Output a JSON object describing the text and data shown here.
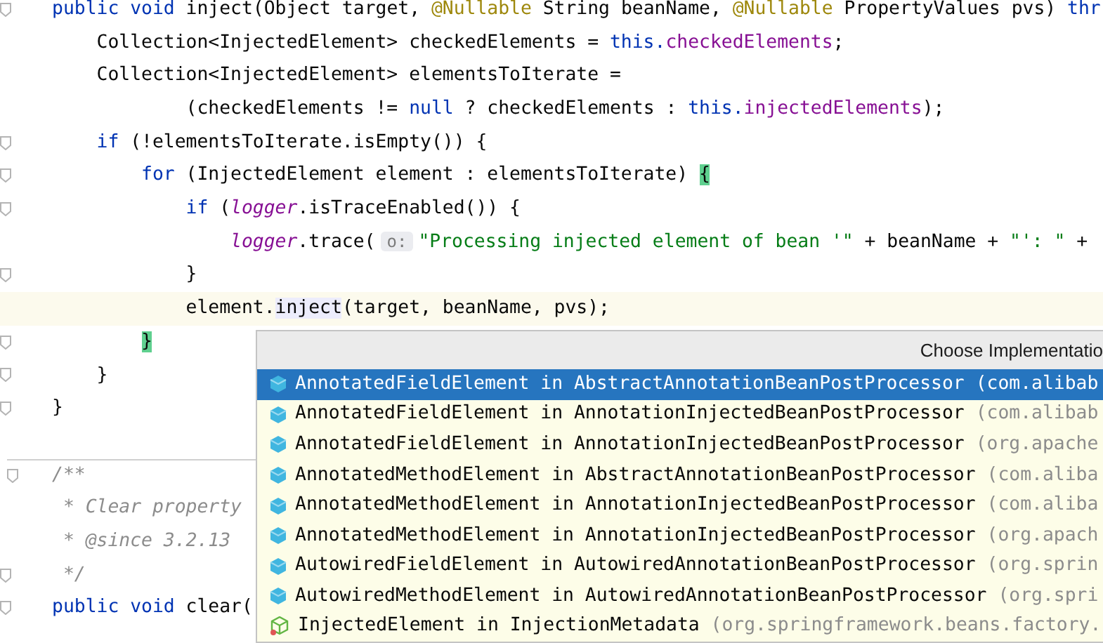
{
  "editor": {
    "lines": [
      {
        "fold": true,
        "tokens": [
          {
            "kind": "kw",
            "text": "public void "
          },
          {
            "kind": "plain",
            "text": "inject(Object target, "
          },
          {
            "kind": "ann",
            "text": "@Nullable"
          },
          {
            "kind": "plain",
            "text": " String beanName, "
          },
          {
            "kind": "ann",
            "text": "@Nullable"
          },
          {
            "kind": "plain",
            "text": " PropertyValues pvs) "
          },
          {
            "kind": "kw",
            "text": "thr"
          }
        ]
      },
      {
        "tokens": [
          {
            "kind": "plain",
            "text": "    Collection<InjectedElement> checkedElements = "
          },
          {
            "kind": "kw",
            "text": "this."
          },
          {
            "kind": "field",
            "text": "checkedElements"
          },
          {
            "kind": "plain",
            "text": ";"
          }
        ]
      },
      {
        "tokens": [
          {
            "kind": "plain",
            "text": "    Collection<InjectedElement> elementsToIterate ="
          }
        ]
      },
      {
        "tokens": [
          {
            "kind": "plain",
            "text": "            (checkedElements != "
          },
          {
            "kind": "kw",
            "text": "null"
          },
          {
            "kind": "plain",
            "text": " ? checkedElements : "
          },
          {
            "kind": "kw",
            "text": "this."
          },
          {
            "kind": "field",
            "text": "injectedElements"
          },
          {
            "kind": "plain",
            "text": ");"
          }
        ]
      },
      {
        "fold": true,
        "tokens": [
          {
            "kind": "kw",
            "text": "    if"
          },
          {
            "kind": "plain",
            "text": " (!elementsToIterate.isEmpty()) {"
          }
        ]
      },
      {
        "fold": true,
        "tokens": [
          {
            "kind": "kw",
            "text": "        for"
          },
          {
            "kind": "plain",
            "text": " (InjectedElement element : elementsToIterate) "
          },
          {
            "kind": "match",
            "text": "{"
          }
        ]
      },
      {
        "fold": true,
        "tokens": [
          {
            "kind": "kw",
            "text": "            if"
          },
          {
            "kind": "plain",
            "text": " ("
          },
          {
            "kind": "static",
            "text": "logger"
          },
          {
            "kind": "plain",
            "text": ".isTraceEnabled()) {"
          }
        ]
      },
      {
        "tokens": [
          {
            "kind": "static",
            "text": "                logger"
          },
          {
            "kind": "plain",
            "text": ".trace("
          },
          {
            "kind": "hint",
            "text": "o:"
          },
          {
            "kind": "str",
            "text": "\"Processing injected element of bean '\""
          },
          {
            "kind": "plain",
            "text": " + beanName + "
          },
          {
            "kind": "str",
            "text": "\"': \""
          },
          {
            "kind": "plain",
            "text": " +"
          }
        ]
      },
      {
        "fold": true,
        "tokens": [
          {
            "kind": "plain",
            "text": "            }"
          }
        ]
      },
      {
        "caret": true,
        "tokens": [
          {
            "kind": "plain",
            "text": "            element."
          },
          {
            "kind": "usage",
            "text": "inject"
          },
          {
            "kind": "plain",
            "text": "(target, beanName, pvs);"
          }
        ]
      },
      {
        "fold": true,
        "tokens": [
          {
            "kind": "match",
            "text": "        }"
          }
        ]
      },
      {
        "fold": true,
        "tokens": [
          {
            "kind": "plain",
            "text": "    }"
          }
        ]
      },
      {
        "fold": true,
        "tokens": [
          {
            "kind": "plain",
            "text": "}"
          }
        ]
      },
      {
        "fold": true,
        "separator": true,
        "tokens": [
          {
            "kind": "comment",
            "text": "/**"
          }
        ]
      },
      {
        "tokens": [
          {
            "kind": "comment",
            "text": " * Clear property"
          }
        ]
      },
      {
        "tokens": [
          {
            "kind": "comment",
            "text": " * @since 3.2.13"
          }
        ]
      },
      {
        "fold": true,
        "tokens": [
          {
            "kind": "comment",
            "text": " */"
          }
        ]
      },
      {
        "fold": true,
        "tokens": [
          {
            "kind": "kw",
            "text": "public void "
          },
          {
            "kind": "plain",
            "text": "clear("
          }
        ]
      }
    ]
  },
  "popup": {
    "title": "Choose Implementatio",
    "items": [
      {
        "kind": "class",
        "selected": true,
        "label": "AnnotatedFieldElement in AbstractAnnotationBeanPostProcessor",
        "package": "(com.alibab"
      },
      {
        "kind": "class",
        "selected": false,
        "label": "AnnotatedFieldElement in AnnotationInjectedBeanPostProcessor",
        "package": "(com.alibab"
      },
      {
        "kind": "class",
        "selected": false,
        "label": "AnnotatedFieldElement in AnnotationInjectedBeanPostProcessor",
        "package": "(org.apache"
      },
      {
        "kind": "class",
        "selected": false,
        "label": "AnnotatedMethodElement in AbstractAnnotationBeanPostProcessor",
        "package": "(com.aliba"
      },
      {
        "kind": "class",
        "selected": false,
        "label": "AnnotatedMethodElement in AnnotationInjectedBeanPostProcessor",
        "package": "(com.aliba"
      },
      {
        "kind": "class",
        "selected": false,
        "label": "AnnotatedMethodElement in AnnotationInjectedBeanPostProcessor",
        "package": "(org.apach"
      },
      {
        "kind": "class",
        "selected": false,
        "label": "AutowiredFieldElement in AutowiredAnnotationBeanPostProcessor",
        "package": "(org.sprin"
      },
      {
        "kind": "class",
        "selected": false,
        "label": "AutowiredMethodElement in AutowiredAnnotationBeanPostProcessor",
        "package": "(org.spri"
      },
      {
        "kind": "abstract",
        "selected": false,
        "label": "InjectedElement in InjectionMetadata",
        "package": "(org.springframework.beans.factory."
      }
    ]
  }
}
